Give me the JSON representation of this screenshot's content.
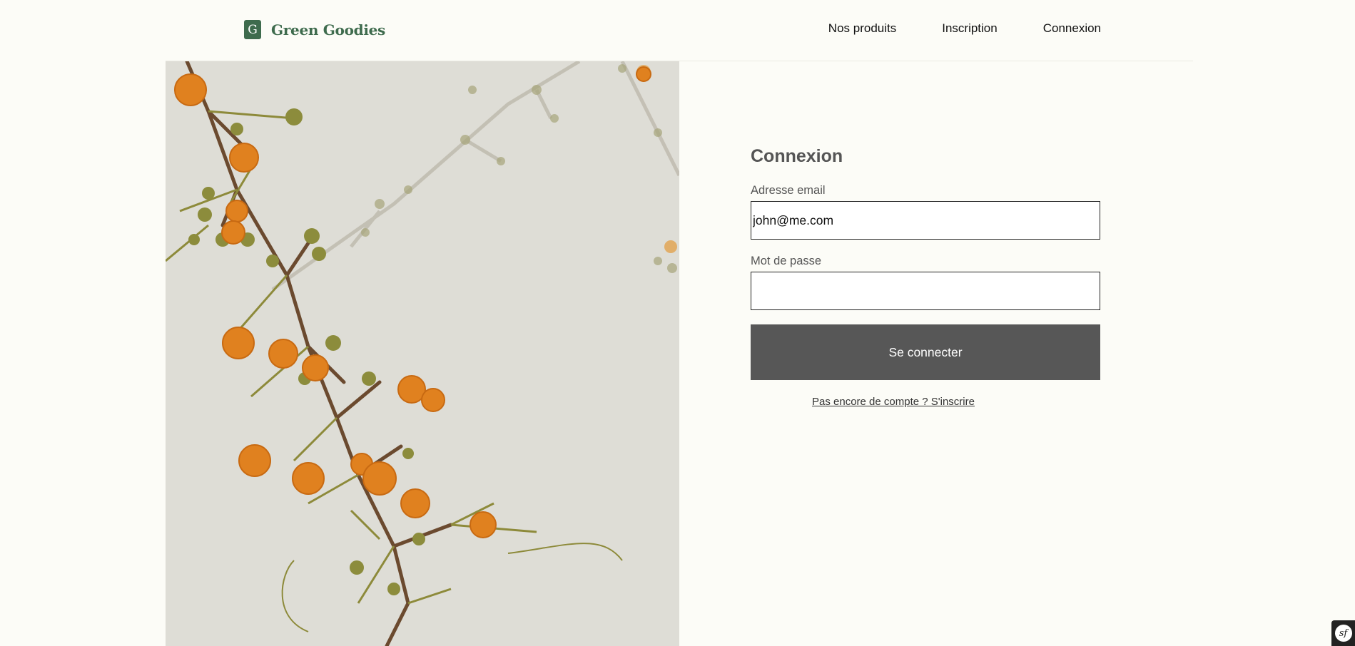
{
  "header": {
    "logo_letter": "G",
    "brand_name": "Green Goodies",
    "brand_color": "#3e6b4d",
    "nav": [
      {
        "label": "Nos produits"
      },
      {
        "label": "Inscription"
      },
      {
        "label": "Connexion"
      }
    ]
  },
  "hero": {
    "image_alt": "Mimosa flowers branch",
    "background_color": "#deddd6",
    "flower_color": "#e0811f"
  },
  "login": {
    "title": "Connexion",
    "email_label": "Adresse email",
    "email_value": "john@me.com",
    "password_label": "Mot de passe",
    "password_value": "",
    "submit_label": "Se connecter",
    "signup_link": "Pas encore de compte ? S'inscrire",
    "button_color": "#575757"
  },
  "debug_toolbar": {
    "icon": "symfony-icon",
    "glyph": "sf"
  }
}
